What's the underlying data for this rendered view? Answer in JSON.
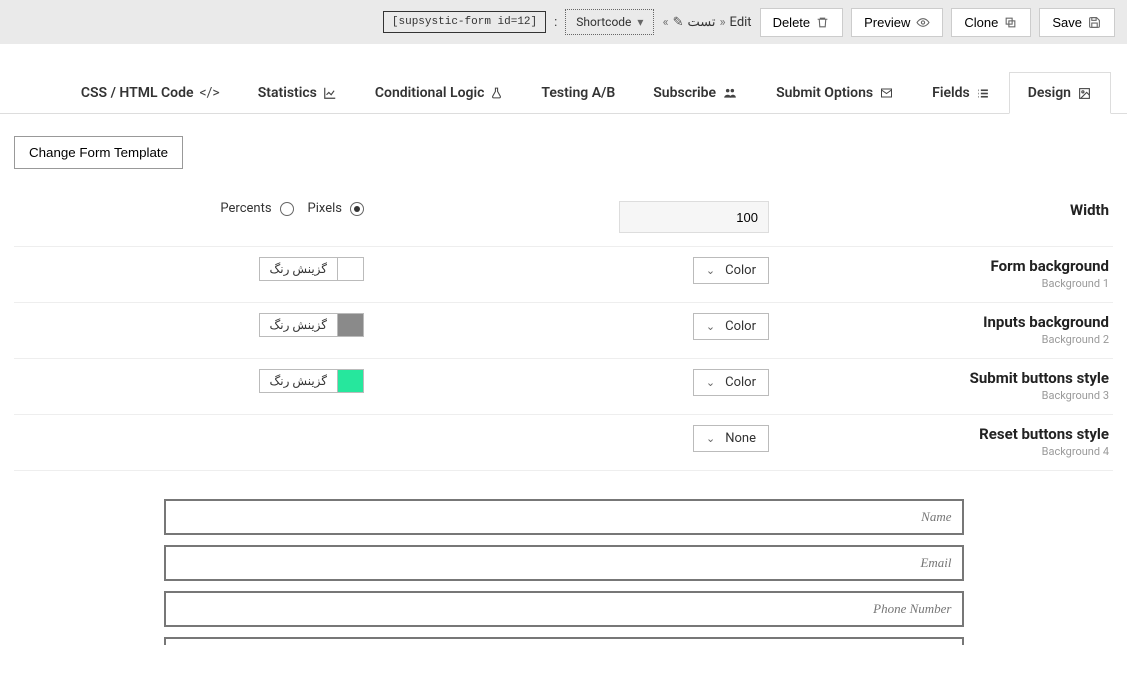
{
  "top": {
    "save": "Save",
    "clone": "Clone",
    "preview": "Preview",
    "delete": "Delete",
    "edit": "Edit",
    "sep": "»",
    "name": "تست",
    "sep2": "«",
    "shortcode_label": "Shortcode",
    "shortcode_val": "[supsystic-form id=12]",
    "shortcode_colon": ":"
  },
  "tabs": {
    "css": "CSS / HTML Code",
    "stats": "Statistics",
    "cond": "Conditional Logic",
    "ab": "Testing A/B",
    "subs": "Subscribe",
    "submit": "Submit Options",
    "fields": "Fields",
    "design": "Design"
  },
  "change_tpl": "Change Form Template",
  "width": {
    "label": "Width",
    "percents": "Percents",
    "pixels": "Pixels",
    "value": "100"
  },
  "dd_color": "Color",
  "dd_none": "None",
  "pick_label": "گزینش رنگ",
  "rows": {
    "r1_title": "Form background",
    "r1_sub": "Background 1",
    "r2_title": "Inputs background",
    "r2_sub": "Background 2",
    "r3_title": "Submit buttons style",
    "r3_sub": "Background 3",
    "r4_title": "Reset buttons style",
    "r4_sub": "Background 4"
  },
  "colors": {
    "r1": "#ffffff",
    "r2": "#8a8a8a",
    "r3": "#26e79d"
  },
  "preview": {
    "name": "Name",
    "email": "Email",
    "phone": "Phone Number"
  }
}
